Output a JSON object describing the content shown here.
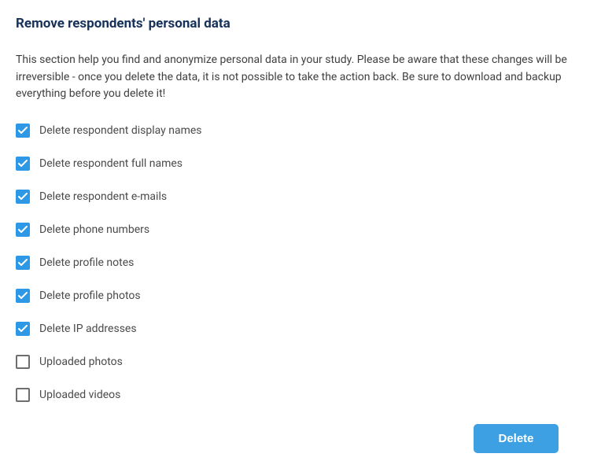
{
  "heading": "Remove respondents' personal data",
  "description": "This section help you find and anonymize personal data in your study. Please be aware that these changes will be irreversible - once you delete the data, it is not possible to take the action back. Be sure to download and backup everything before you delete it!",
  "options": [
    {
      "label": "Delete respondent display names",
      "checked": true
    },
    {
      "label": "Delete respondent full names",
      "checked": true
    },
    {
      "label": "Delete respondent e-mails",
      "checked": true
    },
    {
      "label": "Delete phone numbers",
      "checked": true
    },
    {
      "label": "Delete profile notes",
      "checked": true
    },
    {
      "label": "Delete profile photos",
      "checked": true
    },
    {
      "label": "Delete IP addresses",
      "checked": true
    },
    {
      "label": "Uploaded photos",
      "checked": false
    },
    {
      "label": "Uploaded videos",
      "checked": false
    }
  ],
  "actions": {
    "delete_label": "Delete"
  }
}
